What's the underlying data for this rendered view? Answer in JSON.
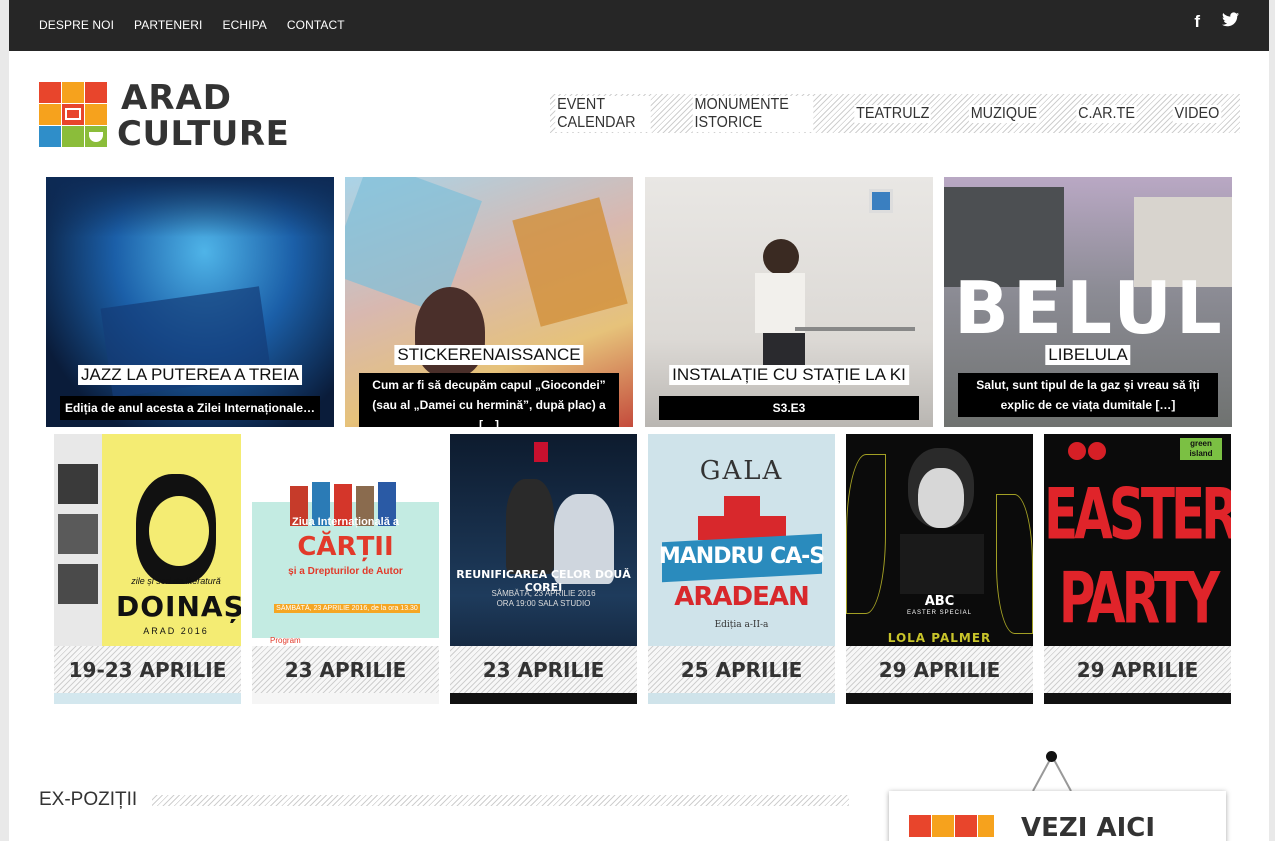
{
  "topbar": {
    "links": [
      "DESPRE NOI",
      "PARTENERI",
      "ECHIPA",
      "CONTACT"
    ],
    "social": [
      {
        "icon": "facebook-icon",
        "glyph": "f"
      },
      {
        "icon": "twitter-icon",
        "glyph": "🐦"
      }
    ]
  },
  "logo": {
    "line1": "ARAD",
    "line2": "CULTURE",
    "colors": [
      "#e8452c",
      "#f6a21d",
      "#2f8ec9",
      "#8bbd3a"
    ]
  },
  "nav": {
    "items": [
      "EVENT CALENDAR",
      "MONUMENTE ISTORICE",
      "TEATRULZ",
      "MUZIQUE",
      "C.AR.TE",
      "VIDEO"
    ]
  },
  "features": [
    {
      "title": "JAZZ LA PUTEREA A TREIA",
      "text": "Ediția de anul acesta a Zilei Internaționale…"
    },
    {
      "title": "STICKERENAISSANCE",
      "text": "Cum ar fi să decupăm capul „Giocondei” (sau al „Damei cu hermină”, după plac) a […]"
    },
    {
      "title": "INSTALAȚIE CU STAȚIE LA KI",
      "text": "S3.E3"
    },
    {
      "title": "LIBELULA",
      "text": "Salut, sunt tipul de la gaz și vreau să îți explic de ce viața dumitale […]",
      "overlay": "BELUL"
    }
  ],
  "events": [
    {
      "date": "19-23 APRILIE",
      "poster": [
        "zile și seri de literatură",
        "DOINAȘ",
        "ARAD 2016"
      ]
    },
    {
      "date": "23 APRILIE",
      "poster": [
        "Ziua Internațională a",
        "CĂRȚII",
        "și a Drepturilor de Autor",
        "SÂMBĂTĂ, 23 APRILIE 2016, de la ora 13.30",
        "Program"
      ]
    },
    {
      "date": "23 APRILIE",
      "poster": [
        "REUNIFICAREA CELOR DOUĂ COREI",
        "SÂMBĂTĂ, 23 APRILIE 2016",
        "ORA 19:00 SALA STUDIO"
      ]
    },
    {
      "date": "25 APRILIE",
      "poster": [
        "GALA",
        "MANDRU CA-S",
        "ARADEAN",
        "Ediția a-II-a"
      ]
    },
    {
      "date": "29 APRILIE",
      "poster": [
        "ABC",
        "EASTER SPECIAL",
        "LOLA PALMER"
      ]
    },
    {
      "date": "29 APRILIE",
      "poster": [
        "EASTER",
        "PARTY",
        "green island"
      ]
    }
  ],
  "expo": {
    "title": "EX-POZIȚII"
  },
  "sign": {
    "title": "VEZI AICI"
  }
}
